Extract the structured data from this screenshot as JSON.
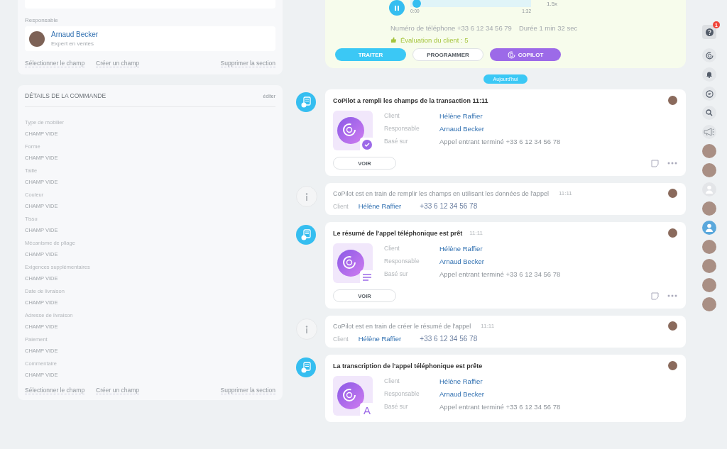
{
  "left": {
    "responsible_section": {
      "label": "Responsable",
      "person": {
        "name": "Arnaud Becker",
        "role": "Expert en ventes"
      },
      "actions": [
        "Sélectionner le champ",
        "Créer un champ"
      ],
      "delete": "Supprimer la section"
    },
    "order_details": {
      "title": "DÉTAILS DE LA COMMANDE",
      "edit": "éditer",
      "fields": [
        {
          "label": "Type de mobilier",
          "value": "CHAMP VIDE"
        },
        {
          "label": "Forme",
          "value": "CHAMP VIDE"
        },
        {
          "label": "Taille",
          "value": "CHAMP VIDE"
        },
        {
          "label": "Couleur",
          "value": "CHAMP VIDE"
        },
        {
          "label": "Tissu",
          "value": "CHAMP VIDE"
        },
        {
          "label": "Mécanisme de pliage",
          "value": "CHAMP VIDE"
        },
        {
          "label": "Exigences supplémentaires",
          "value": "CHAMP VIDE"
        },
        {
          "label": "Date de livraison",
          "value": "CHAMP VIDE"
        },
        {
          "label": "Adresse de livraison",
          "value": "CHAMP VIDE"
        },
        {
          "label": "Paiement",
          "value": "CHAMP VIDE"
        },
        {
          "label": "Commentaire",
          "value": "CHAMP VIDE"
        }
      ],
      "actions": [
        "Sélectionner le champ",
        "Créer un champ"
      ],
      "delete": "Supprimer la section"
    }
  },
  "call": {
    "player": {
      "level": 0.05,
      "start": "0:00",
      "end": "1:32",
      "speed": "1.5x"
    },
    "phone": "Numéro de téléphone +33 6 12 34 56 79",
    "duration": "Durée 1 min 32 sec",
    "rating": "Évaluation du client : 5",
    "buttons": [
      {
        "kind": "primary",
        "label": "TRAITER"
      },
      {
        "kind": "outline",
        "label": "PROGRAMMER"
      },
      {
        "kind": "copilot",
        "label": "COPILOT"
      }
    ]
  },
  "date_badge": "Aujourd'hui",
  "timeline": [
    {
      "kind": "event",
      "title": "CoPilot a rempli les champs de la transaction 11:11",
      "badge": {
        "kind": "check"
      },
      "fields": [
        {
          "label": "Client",
          "value": "Hélène Raffier",
          "link": true
        },
        {
          "label": "Responsable",
          "value": "Arnaud Becker",
          "link": true
        },
        {
          "label": "Basé sur",
          "value": "Appel entrant terminé +33 6 12 34 56 78",
          "link": false
        }
      ],
      "button": "VOIR"
    },
    {
      "kind": "info",
      "text": "CoPilot est en train de remplir les champs en utilisant les données de l'appel",
      "time": "11:11",
      "client_label": "Client",
      "client": "Hélène Raffier",
      "phone": "+33 6 12 34 56 78"
    },
    {
      "kind": "event",
      "title": "Le résumé de l'appel téléphonique est prêt",
      "time": "11:11",
      "badge": {
        "kind": "lines"
      },
      "fields": [
        {
          "label": "Client",
          "value": "Hélène Raffier",
          "link": true
        },
        {
          "label": "Responsable",
          "value": "Arnaud Becker",
          "link": true
        },
        {
          "label": "Basé sur",
          "value": "Appel entrant terminé +33 6 12 34 56 78",
          "link": false
        }
      ],
      "button": "VOIR"
    },
    {
      "kind": "info",
      "text": "CoPilot est en train de créer le résumé de l'appel",
      "time": "11:11",
      "client_label": "Client",
      "client": "Hélène Raffier",
      "phone": "+33 6 12 34 56 78"
    },
    {
      "kind": "event",
      "title": "La transcription de l'appel téléphonique est prête",
      "badge": {
        "kind": "letter",
        "text": "A"
      },
      "fields": [
        {
          "label": "Client",
          "value": "Hélène Raffier",
          "link": true
        },
        {
          "label": "Responsable",
          "value": "Arnaud Becker",
          "link": true
        },
        {
          "label": "Basé sur",
          "value": "Appel entrant terminé +33 6 12 34 56 78",
          "link": false
        }
      ]
    }
  ],
  "rail": {
    "help_badge": "1",
    "contacts": [
      {
        "kind": "photo"
      },
      {
        "kind": "photo"
      },
      {
        "kind": "placeholder"
      },
      {
        "kind": "photo"
      },
      {
        "kind": "user"
      },
      {
        "kind": "photo"
      },
      {
        "kind": "photo"
      },
      {
        "kind": "photo"
      },
      {
        "kind": "photo"
      }
    ]
  }
}
